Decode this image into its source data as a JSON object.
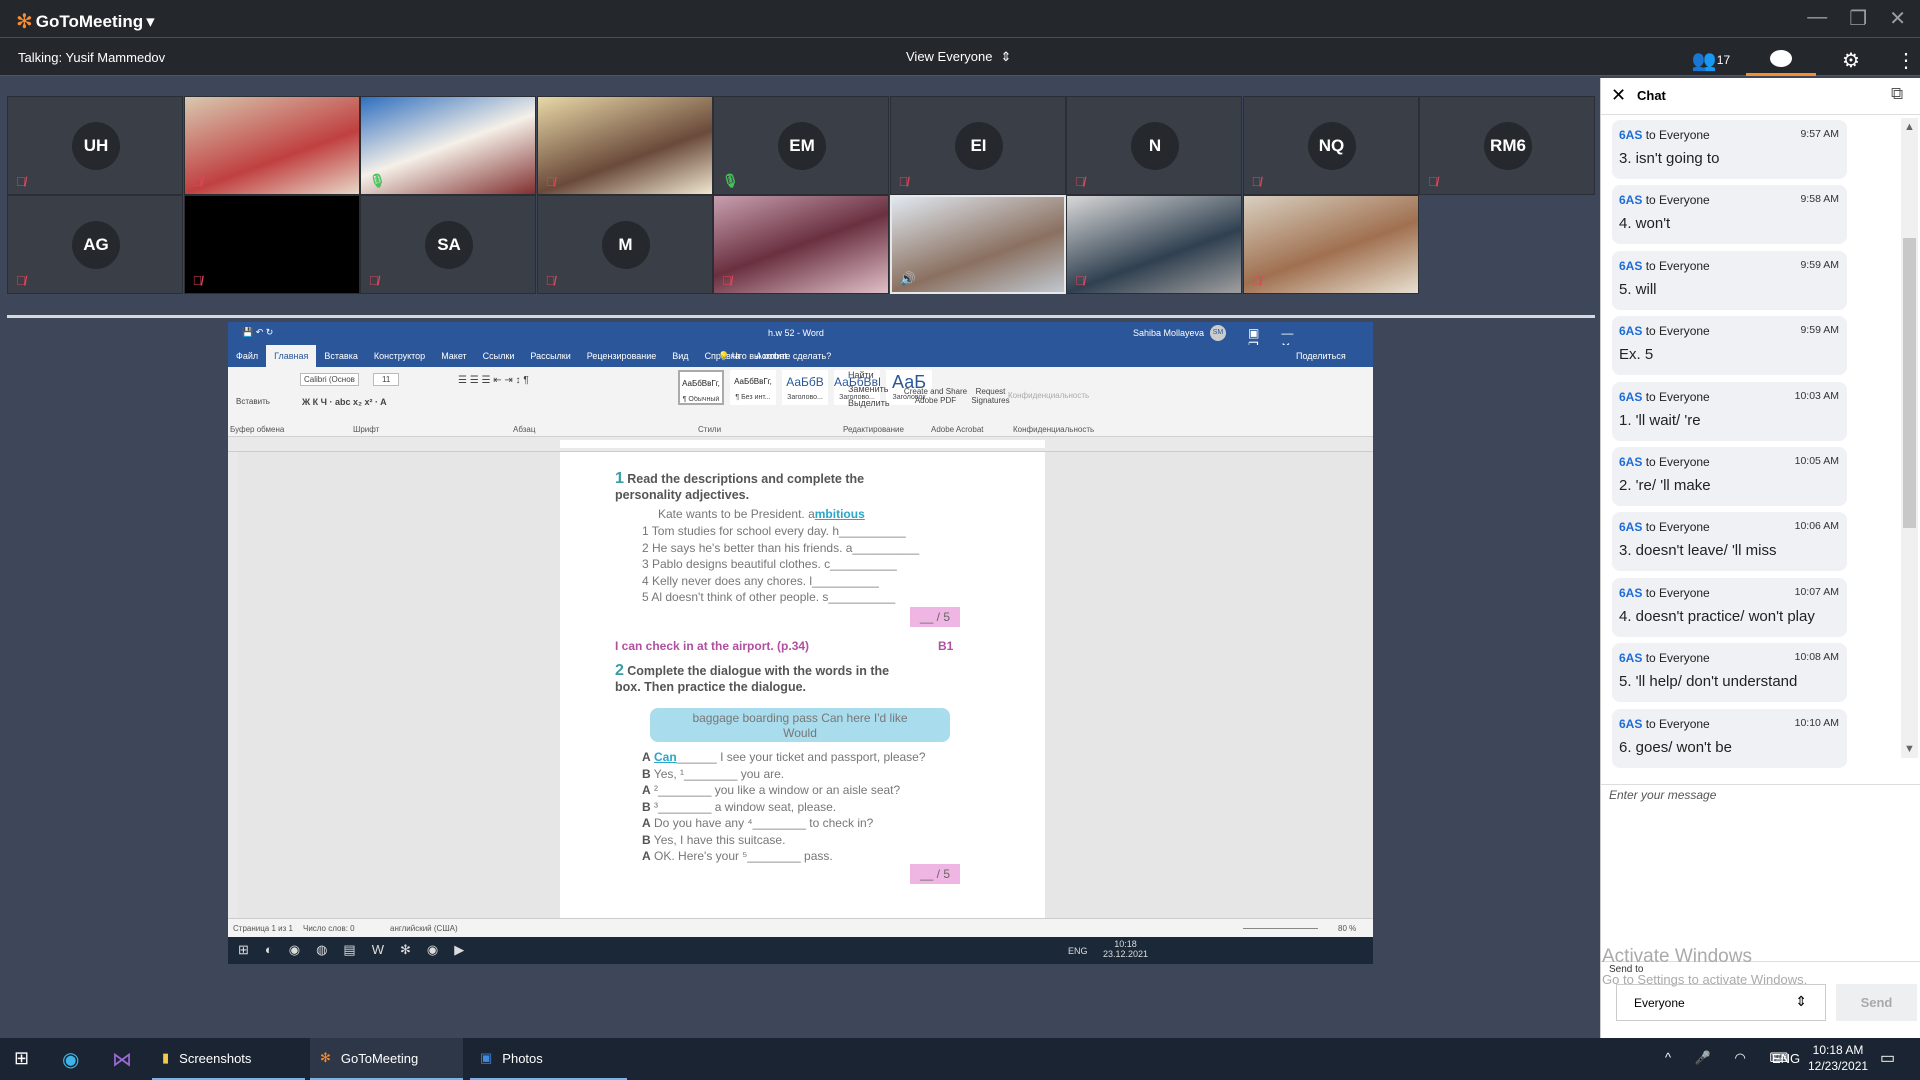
{
  "app": {
    "name": "GoToMeeting",
    "talking": "Talking: Yusif Mammedov",
    "view_label": "View Everyone",
    "participant_count": "17",
    "accent": "#f68d2e"
  },
  "tiles": [
    {
      "initials": "UH",
      "mic": "muted",
      "video": false
    },
    {
      "initials": "",
      "mic": "muted",
      "video": true
    },
    {
      "initials": "",
      "mic": "on",
      "video": true
    },
    {
      "initials": "",
      "mic": "muted",
      "video": true
    },
    {
      "initials": "EM",
      "mic": "on",
      "video": false
    },
    {
      "initials": "EI",
      "mic": "muted",
      "video": false
    },
    {
      "initials": "N",
      "mic": "muted",
      "video": false
    },
    {
      "initials": "NQ",
      "mic": "muted",
      "video": false
    },
    {
      "initials": "RM6",
      "mic": "muted",
      "video": false
    },
    {
      "initials": "AG",
      "mic": "muted",
      "video": false
    },
    {
      "initials": "",
      "mic": "muted",
      "video": "black"
    },
    {
      "initials": "SA",
      "mic": "muted",
      "video": false
    },
    {
      "initials": "M",
      "mic": "muted",
      "video": false
    },
    {
      "initials": "",
      "mic": "muted",
      "video": true
    },
    {
      "initials": "",
      "mic": "speaking",
      "video": true
    },
    {
      "initials": "",
      "mic": "muted",
      "video": true
    },
    {
      "initials": "",
      "mic": "muted",
      "video": true
    }
  ],
  "word": {
    "title": "h.w 52  -  Word",
    "user": "Sahiba Mollayeva",
    "user_initials": "SM",
    "tabs": [
      "Файл",
      "Главная",
      "Вставка",
      "Конструктор",
      "Макет",
      "Ссылки",
      "Рассылки",
      "Рецензирование",
      "Вид",
      "Справка",
      "Acrobat"
    ],
    "tell_me": "Что вы хотите сделать?",
    "share": "Поделиться",
    "ribbon": {
      "paste": "Вставить",
      "font": "Calibri (Основ",
      "size": "11",
      "styles": [
        {
          "sample": "АаБбВвГг,",
          "name": "¶ Обычный"
        },
        {
          "sample": "АаБбВвГг,",
          "name": "¶ Без инт..."
        },
        {
          "sample": "АаБбВ",
          "name": "Заголово..."
        },
        {
          "sample": "АаБбВвГ",
          "name": "Заголово..."
        },
        {
          "sample": "АаБ",
          "name": "Заголовок"
        }
      ],
      "find": "Найти",
      "replace": "Заменить",
      "select": "Выделить",
      "adobe_create": "Create and Share Adobe PDF",
      "adobe_sign": "Request Signatures",
      "privacy": "Конфиденциальность",
      "groups": [
        "Буфер обмена",
        "Шрифт",
        "Абзац",
        "Стили",
        "Редактирование",
        "Adobe Acrobat",
        "Конфиденциальность"
      ]
    },
    "doc": {
      "ex1_num": "1",
      "ex1_title": "Read the descriptions and complete the personality adjectives.",
      "ex1_example": "Kate wants to be President. a",
      "ex1_example_answer": "mbitious",
      "ex1_items": [
        "1  Tom studies for school every day. h__________",
        "2  He says he's better than his friends. a__________",
        "3  Pablo designs beautiful clothes. c__________",
        "4  Kelly never does any chores. l__________",
        "5  Al doesn't think of other people. s__________"
      ],
      "score1": "__ / 5",
      "section": "I can check in at the airport. (p.34)",
      "level": "B1",
      "ex2_num": "2",
      "ex2_title": "Complete the dialogue with the words in the box. Then practice the dialogue.",
      "box_words": "baggage   boarding pass   Can   here   I'd like   Would",
      "dialogue": [
        {
          "s": "A",
          "pre": "",
          "ans": "Can",
          "post": "______ I see your ticket and passport, please?"
        },
        {
          "s": "B",
          "pre": "Yes, ¹________ you are.",
          "ans": "",
          "post": ""
        },
        {
          "s": "A",
          "pre": "²________ you like a window or an aisle seat?",
          "ans": "",
          "post": ""
        },
        {
          "s": "B",
          "pre": "³________ a window seat, please.",
          "ans": "",
          "post": ""
        },
        {
          "s": "A",
          "pre": "Do you have any ⁴________ to check in?",
          "ans": "",
          "post": ""
        },
        {
          "s": "B",
          "pre": "Yes, I have this suitcase.",
          "ans": "",
          "post": ""
        },
        {
          "s": "A",
          "pre": "OK. Here's your ⁵________ pass.",
          "ans": "",
          "post": ""
        }
      ],
      "score2": "__ / 5"
    },
    "status": {
      "page": "Страница 1 из 1",
      "words": "Число слов: 0",
      "lang": "английский (США)",
      "zoom": "80 %"
    },
    "taskbar": {
      "lang": "ENG",
      "time": "10:18",
      "date": "23.12.2021"
    }
  },
  "chat": {
    "title": "Chat",
    "messages": [
      {
        "from": "6AS",
        "to": "to Everyone",
        "time": "9:57 AM",
        "text": "3. isn't going to"
      },
      {
        "from": "6AS",
        "to": "to Everyone",
        "time": "9:58 AM",
        "text": "4. won't"
      },
      {
        "from": "6AS",
        "to": "to Everyone",
        "time": "9:59 AM",
        "text": "5. will"
      },
      {
        "from": "6AS",
        "to": "to Everyone",
        "time": "9:59 AM",
        "text": "Ex. 5"
      },
      {
        "from": "6AS",
        "to": "to Everyone",
        "time": "10:03 AM",
        "text": "1. 'll wait/ 're"
      },
      {
        "from": "6AS",
        "to": "to Everyone",
        "time": "10:05 AM",
        "text": "2. 're/ 'll make"
      },
      {
        "from": "6AS",
        "to": "to Everyone",
        "time": "10:06 AM",
        "text": "3. doesn't leave/ 'll miss"
      },
      {
        "from": "6AS",
        "to": "to Everyone",
        "time": "10:07 AM",
        "text": "4. doesn't practice/ won't play"
      },
      {
        "from": "6AS",
        "to": "to Everyone",
        "time": "10:08 AM",
        "text": "5. 'll help/ don't understand"
      },
      {
        "from": "6AS",
        "to": "to Everyone",
        "time": "10:10 AM",
        "text": "6. goes/ won't be"
      }
    ],
    "placeholder": "Enter your message",
    "send_to_label": "Send to",
    "send_to_value": "Everyone",
    "send": "Send",
    "watermark1": "Activate Windows",
    "watermark2": "Go to Settings to activate Windows."
  },
  "taskbar": {
    "apps": [
      "Screenshots",
      "GoToMeeting",
      "Photos"
    ],
    "lang": "ENG",
    "time": "10:18 AM",
    "date": "12/23/2021"
  }
}
